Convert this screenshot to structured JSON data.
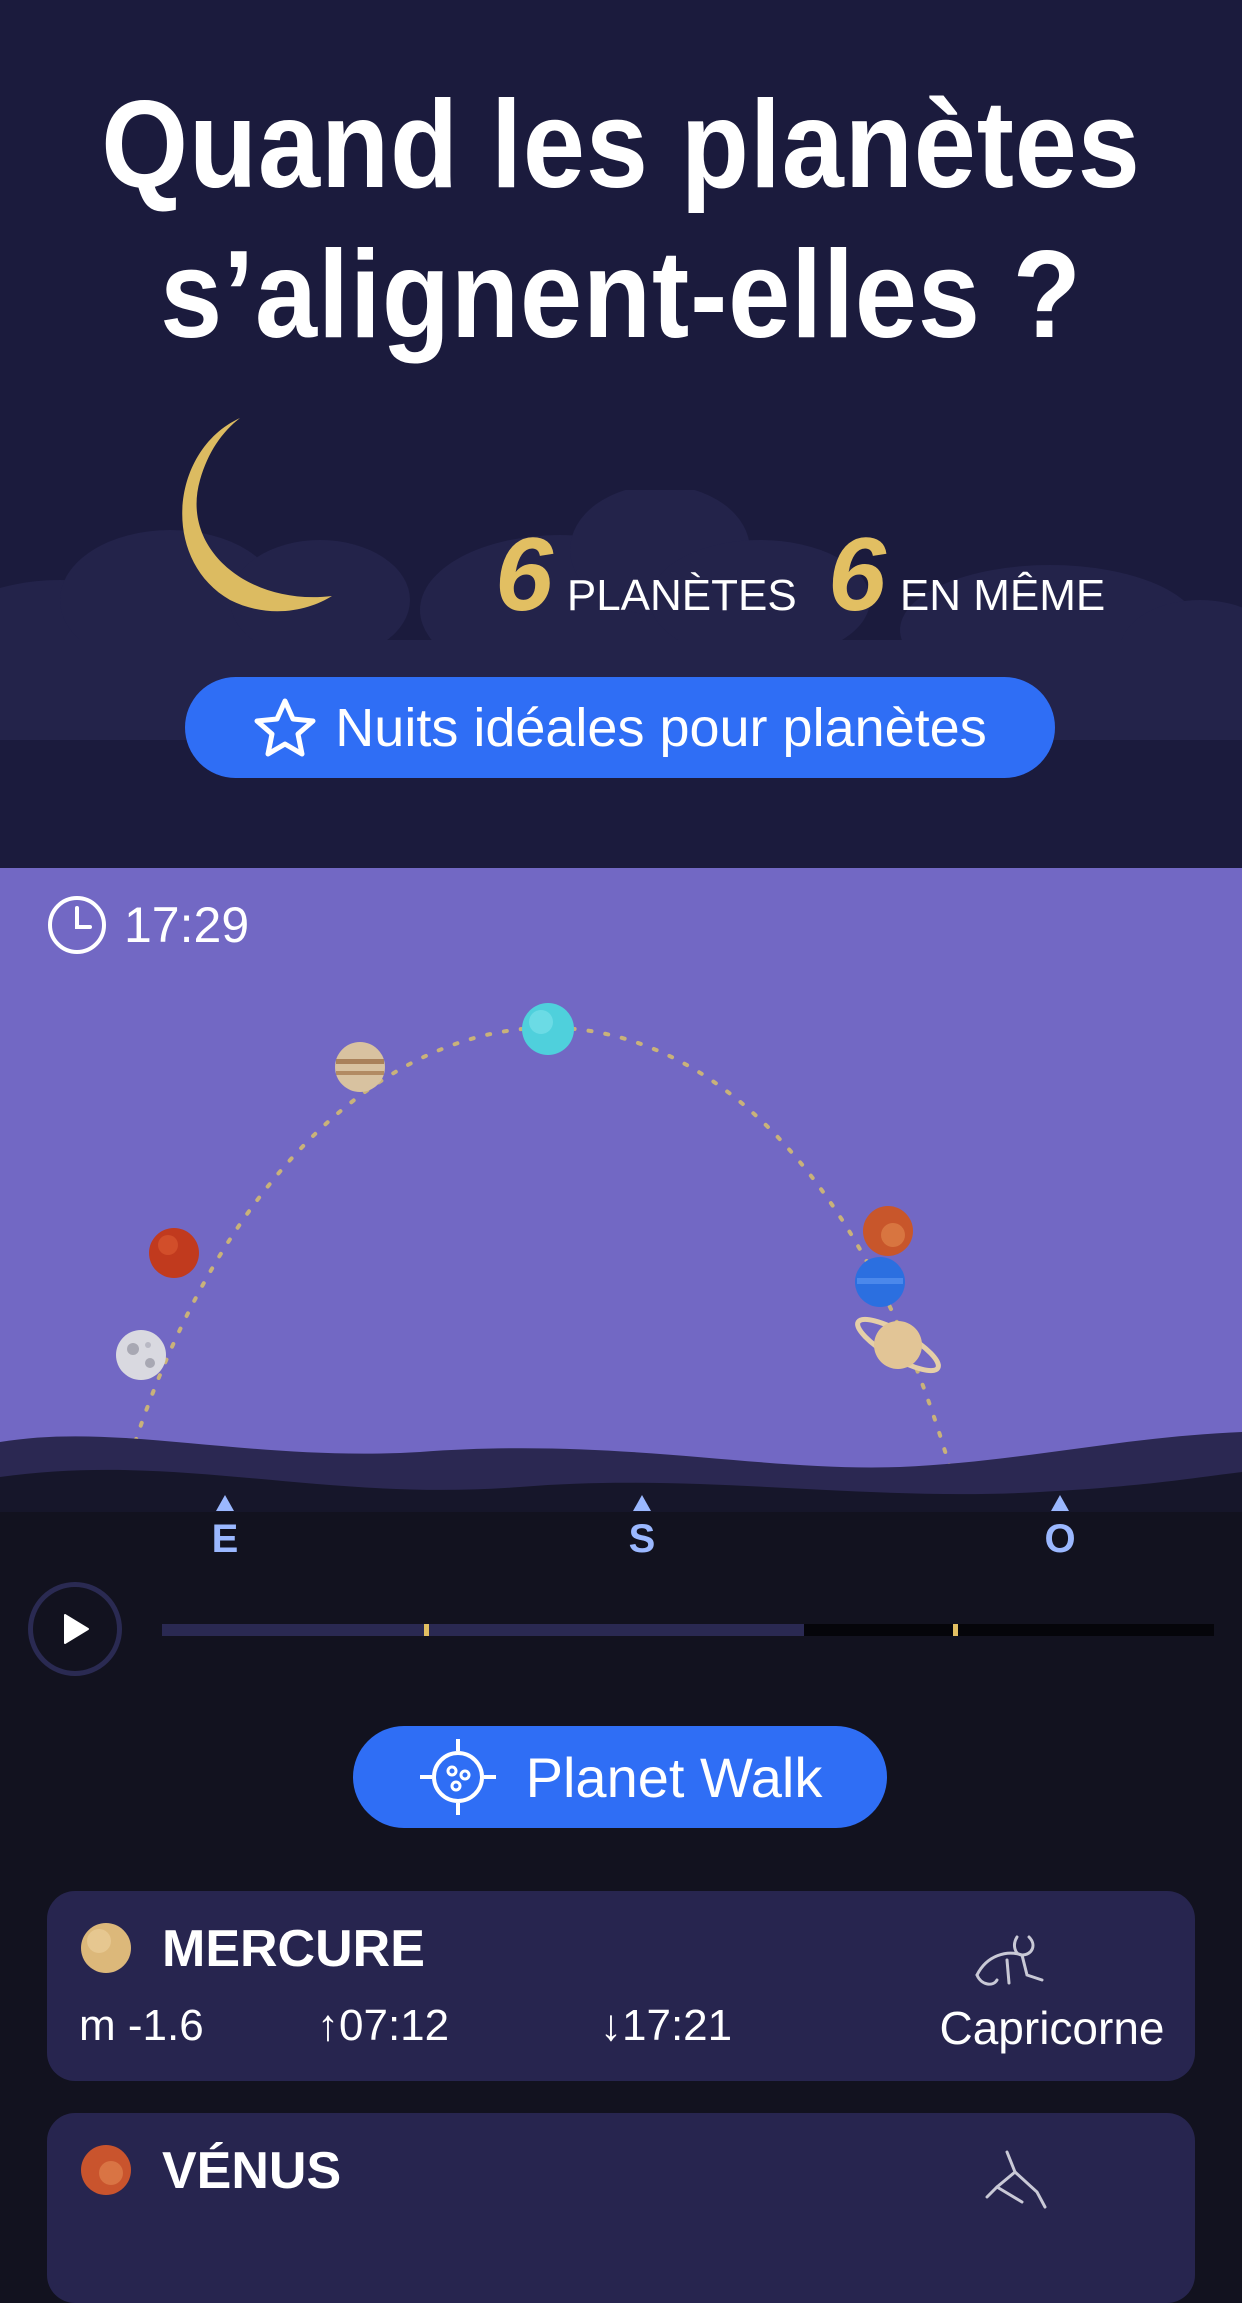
{
  "header": {
    "headline_line1": "Quand les planètes",
    "headline_line2": "s’alignent-elles ?",
    "stat1_number": "6",
    "stat1_label": "PLANÈTES",
    "stat2_number": "6",
    "stat2_label": "EN MÊME",
    "ideal_nights_button": "Nuits idéales pour planètes"
  },
  "sky": {
    "time": "17:29",
    "compass": [
      "E",
      "S",
      "O"
    ],
    "bodies": [
      "moon",
      "mars",
      "jupiter",
      "uranus",
      "venus",
      "neptune",
      "saturn"
    ]
  },
  "controls": {
    "playback_progress": 0.61,
    "planet_walk_button": "Planet Walk"
  },
  "planets": [
    {
      "name": "MERCURE",
      "magnitude": "m -1.6",
      "rise": "07:12",
      "set": "17:21",
      "constellation": "Capricorne",
      "color": "#dcb87a"
    },
    {
      "name": "VÉNUS",
      "color": "#c9542d"
    }
  ],
  "colors": {
    "accent": "#2f6ef5",
    "gold": "#e2bf62",
    "header_bg": "#1b1b3d",
    "sky_bg": "#7268c4",
    "card_bg": "#27254f"
  }
}
